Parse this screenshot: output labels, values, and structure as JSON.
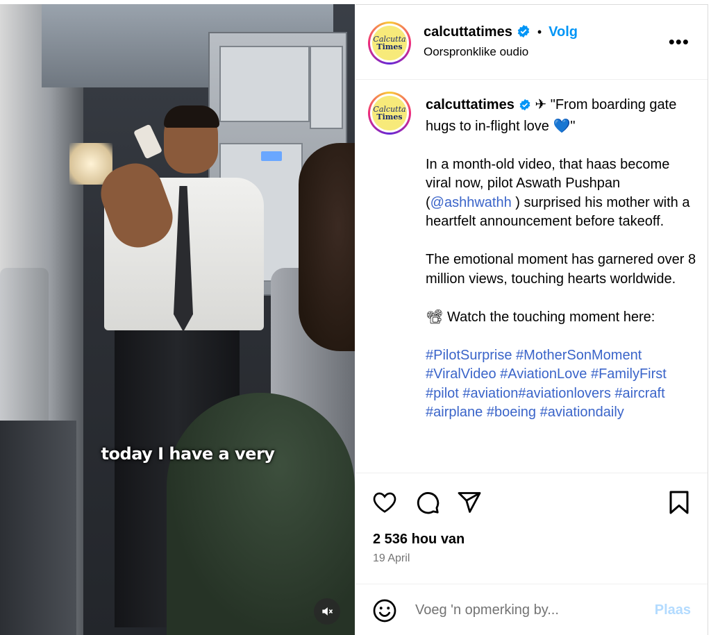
{
  "video": {
    "caption": "today I have a very",
    "mute_icon": "speaker-muted-icon"
  },
  "header": {
    "username": "calcuttatimes",
    "separator": "•",
    "follow_label": "Volg",
    "audio_label": "Oorspronklike oudio",
    "more_label": "•••",
    "avatar_line1": "Calcutta",
    "avatar_line2": "Times"
  },
  "post": {
    "username": "calcuttatimes",
    "headline": "✈ \"From boarding gate hugs to in-flight love 💙\"",
    "para1_before": "In a month-old video, that haas become viral now, pilot Aswath Pushpan (",
    "mention": "@ashhwathh",
    "para1_after": " ) surprised his mother with a heartfelt announcement before takeoff.",
    "para2": "The emotional moment has garnered over 8 million views, touching hearts worldwide.",
    "para3": "📽 Watch the touching moment here:",
    "hashtags": "#PilotSurprise #MotherSonMoment #ViralVideo #AviationLove #FamilyFirst #pilot #aviation#aviationlovers #aircraft #airplane #boeing #aviationdaily"
  },
  "actions": {
    "likes": "2 536 hou van",
    "date": "19 April"
  },
  "comment": {
    "placeholder": "Voeg 'n opmerking by...",
    "post_label": "Plaas"
  },
  "colors": {
    "accent": "#0095f6",
    "link": "#3a64c9",
    "muted": "#737373",
    "post_disabled": "#b3dbff"
  }
}
